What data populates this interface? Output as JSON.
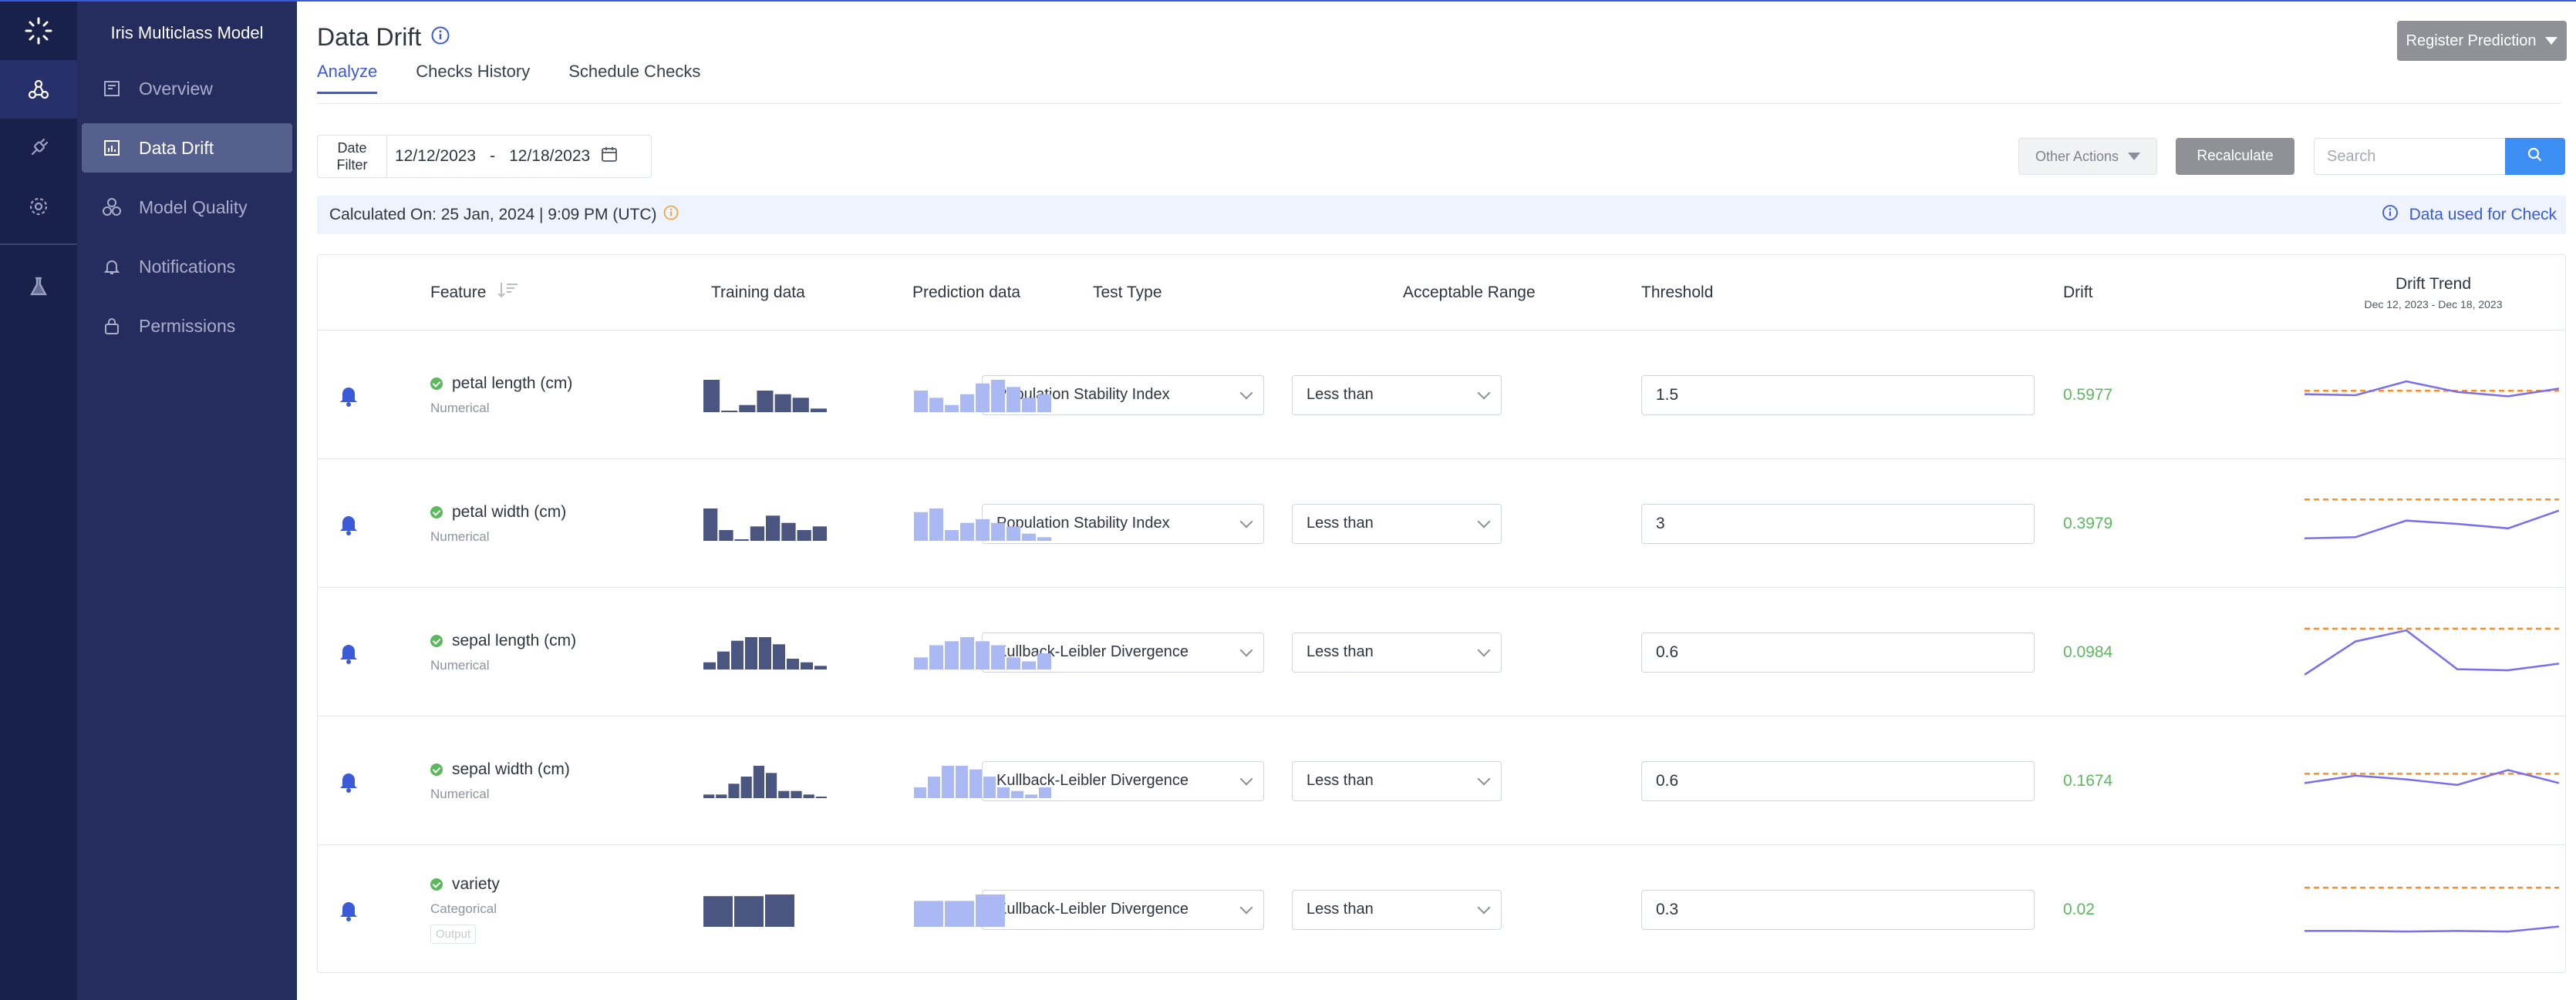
{
  "app": {
    "model_title": "Iris Multiclass Model",
    "sidebar": [
      {
        "label": "Overview",
        "icon": "overview-icon"
      },
      {
        "label": "Data Drift",
        "icon": "chart-icon",
        "active": true
      },
      {
        "label": "Model Quality",
        "icon": "quality-icon"
      },
      {
        "label": "Notifications",
        "icon": "bell-icon"
      },
      {
        "label": "Permissions",
        "icon": "lock-icon"
      }
    ],
    "rail": [
      "logo-icon",
      "model-icon",
      "plug-icon",
      "settings-icon",
      "flask-icon"
    ]
  },
  "header": {
    "title": "Data Drift",
    "tabs": [
      "Analyze",
      "Checks History",
      "Schedule Checks"
    ],
    "active_tab": "Analyze",
    "register_button": "Register Prediction"
  },
  "filters": {
    "date_label_line1": "Date",
    "date_label_line2": "Filter",
    "start_date": "12/12/2023",
    "separator": "-",
    "end_date": "12/18/2023",
    "other_actions": "Other Actions",
    "recalculate": "Recalculate",
    "search_placeholder": "Search"
  },
  "banner": {
    "calculated_on": "Calculated On: 25 Jan, 2024 | 9:09 PM (UTC)",
    "data_used": "Data used for Check"
  },
  "table": {
    "headers": {
      "feature": "Feature",
      "training": "Training data",
      "prediction": "Prediction data",
      "test_type": "Test Type",
      "range": "Acceptable Range",
      "threshold": "Threshold",
      "drift": "Drift",
      "trend": "Drift Trend",
      "trend_range": "Dec 12, 2023 - Dec 18, 2023"
    },
    "rows": [
      {
        "feature": "petal length (cm)",
        "kind": "Numerical",
        "output_tag": "",
        "test_type": "Population Stability Index",
        "range": "Less than",
        "threshold": "1.5",
        "drift": "0.5977",
        "training_hist": [
          9,
          0,
          2,
          6,
          5,
          4,
          1
        ],
        "prediction_hist": [
          6,
          4,
          2,
          5,
          8,
          9,
          7,
          4,
          5
        ],
        "trend": [
          0.52,
          0.5,
          0.75,
          0.56,
          0.48,
          0.62
        ],
        "trend_threshold": 0.58,
        "trend_ylim": [
          0,
          1
        ]
      },
      {
        "feature": "petal width (cm)",
        "kind": "Numerical",
        "output_tag": "",
        "test_type": "Population Stability Index",
        "range": "Less than",
        "threshold": "3",
        "drift": "0.3979",
        "training_hist": [
          9,
          3,
          0,
          4,
          7,
          5,
          3,
          4
        ],
        "prediction_hist": [
          8,
          9,
          3,
          5,
          6,
          5,
          4,
          2,
          1
        ],
        "trend": [
          0.12,
          0.13,
          0.28,
          0.25,
          0.21,
          0.37
        ],
        "trend_threshold": 0.47,
        "trend_ylim": [
          0,
          0.5
        ]
      },
      {
        "feature": "sepal length (cm)",
        "kind": "Numerical",
        "output_tag": "",
        "test_type": "Kullback-Leibler Divergence",
        "range": "Less than",
        "threshold": "0.6",
        "drift": "0.0984",
        "training_hist": [
          2,
          5,
          8,
          9,
          9,
          7,
          3,
          2,
          1
        ],
        "prediction_hist": [
          3,
          6,
          7,
          8,
          7,
          6,
          3,
          2,
          4
        ],
        "trend": [
          0.01,
          0.07,
          0.09,
          0.02,
          0.018,
          0.03
        ],
        "trend_threshold": 0.093,
        "trend_ylim": [
          0,
          0.1
        ]
      },
      {
        "feature": "sepal width (cm)",
        "kind": "Numerical",
        "output_tag": "",
        "test_type": "Kullback-Leibler Divergence",
        "range": "Less than",
        "threshold": "0.6",
        "drift": "0.1674",
        "training_hist": [
          1,
          1,
          4,
          6,
          9,
          7,
          2,
          2,
          1,
          0.3
        ],
        "prediction_hist": [
          3,
          6,
          9,
          9,
          8,
          6,
          3,
          2,
          1,
          3
        ],
        "trend": [
          0.48,
          0.56,
          0.52,
          0.46,
          0.62,
          0.48
        ],
        "trend_threshold": 0.58,
        "trend_ylim": [
          0.2,
          0.8
        ]
      },
      {
        "feature": "variety",
        "kind": "Categorical",
        "output_tag": "Output",
        "test_type": "Kullback-Leibler Divergence",
        "range": "Less than",
        "threshold": "0.3",
        "drift": "0.02",
        "training_hist": [
          9,
          9,
          9.5
        ],
        "prediction_hist": [
          8,
          8,
          10
        ],
        "trend": [
          0.012,
          0.012,
          0.011,
          0.012,
          0.011,
          0.02
        ],
        "trend_threshold": 0.09,
        "trend_ylim": [
          0,
          0.1
        ]
      }
    ]
  },
  "colors": {
    "accent": "#3b5ad8",
    "training_bar": "#4a5580",
    "prediction_bar": "#aab8f4",
    "trend_line": "#7a6ef0",
    "threshold_line": "#f09030",
    "drift_ok": "#5cb85c"
  }
}
